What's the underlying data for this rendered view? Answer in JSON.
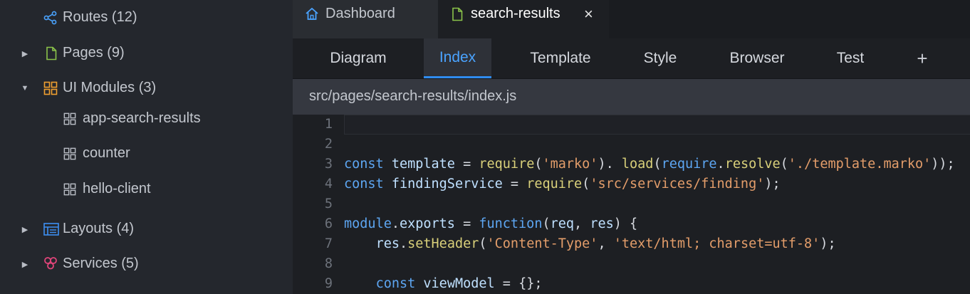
{
  "sidebar": {
    "items": [
      {
        "label": "Routes (12)",
        "icon": "share-icon",
        "expanded": null
      },
      {
        "label": "Pages (9)",
        "icon": "file-icon",
        "expanded": false
      },
      {
        "label": "UI Modules (3)",
        "icon": "grid-icon",
        "expanded": true
      },
      {
        "label": "app-search-results",
        "icon": "grid-icon"
      },
      {
        "label": "counter",
        "icon": "grid-icon"
      },
      {
        "label": "hello-client",
        "icon": "grid-icon"
      },
      {
        "label": "Layouts (4)",
        "icon": "layout-icon",
        "expanded": false
      },
      {
        "label": "Services (5)",
        "icon": "services-icon",
        "expanded": false
      }
    ]
  },
  "file_tabs": [
    {
      "label": "Dashboard",
      "icon": "home-icon",
      "active": false
    },
    {
      "label": "search-results",
      "icon": "file-icon",
      "active": true,
      "close": "×"
    }
  ],
  "view_tabs": [
    {
      "label": "Diagram"
    },
    {
      "label": "Index",
      "active": true
    },
    {
      "label": "Template"
    },
    {
      "label": "Style"
    },
    {
      "label": "Browser"
    },
    {
      "label": "Test"
    },
    {
      "label": "+"
    }
  ],
  "path": "src/pages/search-results/index.js",
  "code": {
    "lines": [
      {
        "n": "1",
        "tokens": []
      },
      {
        "n": "2",
        "tokens": []
      },
      {
        "n": "3",
        "tokens": [
          [
            "kw",
            "const"
          ],
          [
            "plain",
            " "
          ],
          [
            "ident",
            "template"
          ],
          [
            "plain",
            " = "
          ],
          [
            "fn",
            "require"
          ],
          [
            "plain",
            "("
          ],
          [
            "str",
            "'marko'"
          ],
          [
            "plain",
            "). "
          ],
          [
            "fn",
            "load"
          ],
          [
            "plain",
            "("
          ],
          [
            "kw",
            "require"
          ],
          [
            "plain",
            "."
          ],
          [
            "fn",
            "resolve"
          ],
          [
            "plain",
            "("
          ],
          [
            "str",
            "'./template.marko'"
          ],
          [
            "plain",
            "));"
          ]
        ]
      },
      {
        "n": "4",
        "tokens": [
          [
            "kw",
            "const"
          ],
          [
            "plain",
            " "
          ],
          [
            "ident",
            "findingService"
          ],
          [
            "plain",
            " = "
          ],
          [
            "fn",
            "require"
          ],
          [
            "plain",
            "("
          ],
          [
            "str",
            "'src/services/finding'"
          ],
          [
            "plain",
            ");"
          ]
        ]
      },
      {
        "n": "5",
        "tokens": []
      },
      {
        "n": "6",
        "tokens": [
          [
            "kw",
            "module"
          ],
          [
            "plain",
            "."
          ],
          [
            "ident",
            "exports"
          ],
          [
            "plain",
            " = "
          ],
          [
            "kw",
            "function"
          ],
          [
            "plain",
            "("
          ],
          [
            "ident",
            "req"
          ],
          [
            "plain",
            ", "
          ],
          [
            "ident",
            "res"
          ],
          [
            "plain",
            ") {"
          ]
        ]
      },
      {
        "n": "7",
        "tokens": [
          [
            "plain",
            "    "
          ],
          [
            "ident",
            "res"
          ],
          [
            "plain",
            "."
          ],
          [
            "fn",
            "setHeader"
          ],
          [
            "plain",
            "("
          ],
          [
            "str",
            "'Content-Type'"
          ],
          [
            "plain",
            ", "
          ],
          [
            "str",
            "'text/html; charset=utf-8'"
          ],
          [
            "plain",
            ");"
          ]
        ]
      },
      {
        "n": "8",
        "tokens": []
      },
      {
        "n": "9",
        "tokens": [
          [
            "plain",
            "    "
          ],
          [
            "kw",
            "const"
          ],
          [
            "plain",
            " "
          ],
          [
            "ident",
            "viewModel"
          ],
          [
            "plain",
            " = {};"
          ]
        ]
      }
    ]
  },
  "colors": {
    "accent": "#2f8cf0",
    "keyword": "#5da6f2",
    "function": "#d9d07a",
    "string": "#e39d6a"
  }
}
